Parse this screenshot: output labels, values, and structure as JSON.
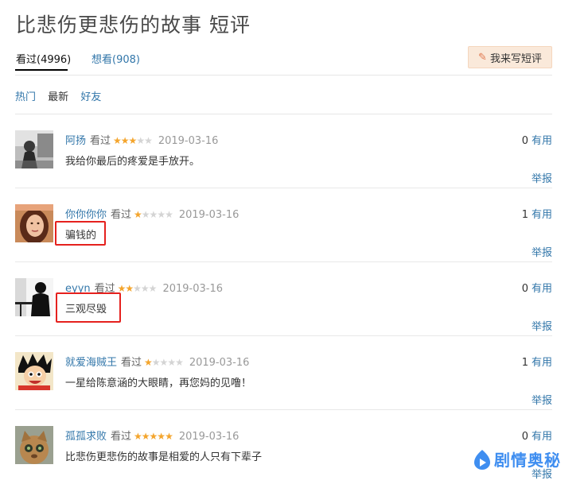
{
  "page": {
    "title": "比悲伤更悲伤的故事 短评",
    "tabs": [
      {
        "label": "看过(4996)"
      },
      {
        "label": "想看(908)"
      }
    ],
    "write_button": {
      "label": "我来写短评",
      "icon": "pencil-icon"
    },
    "filters": [
      {
        "label": "热门"
      },
      {
        "label": "最新"
      },
      {
        "label": "好友"
      }
    ]
  },
  "comments": [
    {
      "user": "阿扬",
      "status": "看过",
      "rating": 3,
      "date": "2019-03-16",
      "votes": "0",
      "votes_label": "有用",
      "text": "我给你最后的疼爱是手放开。",
      "report": "举报"
    },
    {
      "user": "你你你你",
      "status": "看过",
      "rating": 1,
      "date": "2019-03-16",
      "votes": "1",
      "votes_label": "有用",
      "text": "骗钱的",
      "report": "举报"
    },
    {
      "user": "eyyn",
      "status": "看过",
      "rating": 2,
      "date": "2019-03-16",
      "votes": "0",
      "votes_label": "有用",
      "text": "三观尽毁",
      "report": "举报"
    },
    {
      "user": "就爱海贼王",
      "status": "看过",
      "rating": 1,
      "date": "2019-03-16",
      "votes": "1",
      "votes_label": "有用",
      "text": "一星给陈意涵的大眼睛，再您妈的见噜！",
      "report": "举报"
    },
    {
      "user": "孤孤求败",
      "status": "看过",
      "rating": 5,
      "date": "2019-03-16",
      "votes": "0",
      "votes_label": "有用",
      "text": "比悲伤更悲伤的故事是相爱的人只有下辈子",
      "report": "举报"
    }
  ],
  "watermark": {
    "text": "剧情奥秘"
  },
  "colors": {
    "link": "#3377aa",
    "star": "#f4a52d",
    "highlight": "#e5211e",
    "button_bg": "#fae9da"
  }
}
